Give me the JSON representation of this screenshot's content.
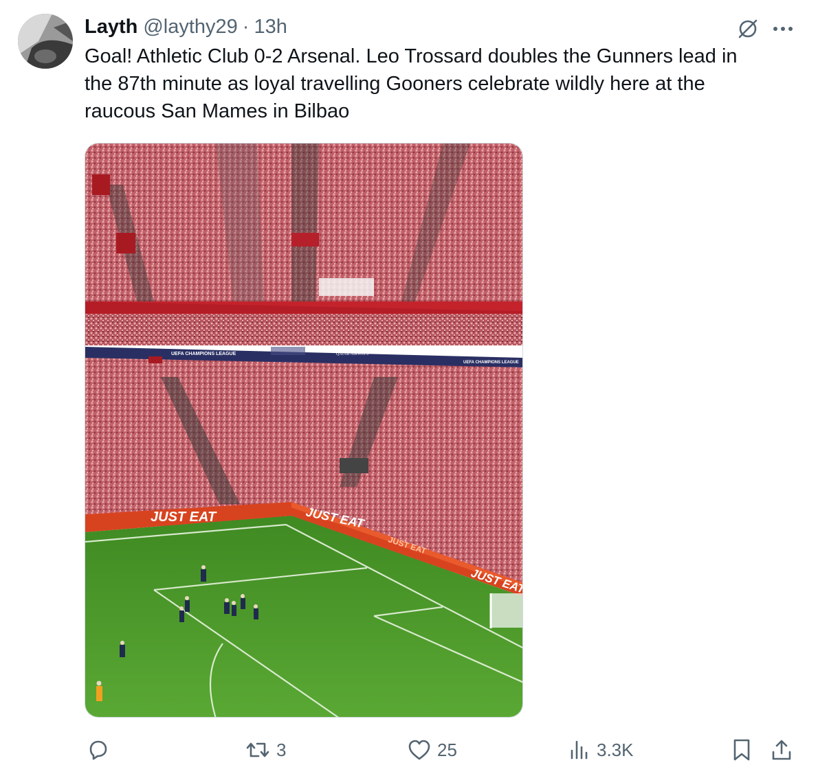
{
  "author": {
    "name": "Layth",
    "handle": "@laythy29",
    "time": "13h"
  },
  "post": {
    "lines": [
      "Goal! Athletic Club 0-2 Arsenal. Leo Trossard doubles the Gunners lead in",
      "the 87th minute as loyal travelling Gooners celebrate wildly here at the",
      "raucous San Mames in Bilbao"
    ]
  },
  "media": {
    "banner_left": "UEFA CHAMPIONS LEAGUE",
    "banner_mid": "QATAR AIRWAYS",
    "banner_right": "UEFA CHAMPIONS LEAGUE",
    "board_1": "JUST EAT",
    "board_2": "JUST EAT",
    "board_3": "JUST EAT",
    "board_4": "JUST EAT"
  },
  "actions": {
    "reply_count": "",
    "repost_count": "3",
    "like_count": "25",
    "views_count": "3.3K"
  },
  "colors": {
    "text": "#0f1419",
    "secondary": "#536471",
    "pitch": "#4f9a2c",
    "crowd": "#c8686e"
  },
  "icons": [
    "grok-icon",
    "more-icon",
    "reply-icon",
    "repost-icon",
    "like-icon",
    "views-icon",
    "bookmark-icon",
    "share-icon"
  ]
}
